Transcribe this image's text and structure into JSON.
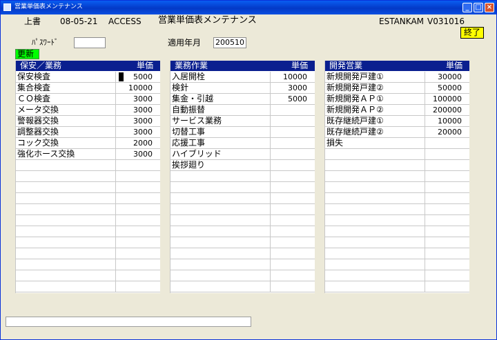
{
  "window": {
    "title": "営業単価表メンテナンス"
  },
  "header": {
    "mode": "上書",
    "date": "08-05-21",
    "app": "ACCESS",
    "screen_title": "営業単価表メンテナンス",
    "user": "ESTANKAM",
    "program_id": "V031016",
    "end_label": "終了"
  },
  "form": {
    "password_label": "ﾊﾟｽﾜｰﾄﾞ",
    "password_value": "",
    "period_label": "適用年月",
    "period_value": "200510",
    "update_label": "更新"
  },
  "grids": [
    {
      "title": "保安／業務",
      "price_header": "単価",
      "rows": [
        {
          "name": "保安検査",
          "price": "5000"
        },
        {
          "name": "集合検査",
          "price": "10000"
        },
        {
          "name": "ＣＯ検査",
          "price": "3000"
        },
        {
          "name": "メータ交換",
          "price": "3000"
        },
        {
          "name": "警報器交換",
          "price": "3000"
        },
        {
          "name": "調整器交換",
          "price": "3000"
        },
        {
          "name": "コック交換",
          "price": "2000"
        },
        {
          "name": "強化ホース交換",
          "price": "3000"
        },
        {
          "name": "",
          "price": ""
        },
        {
          "name": "",
          "price": ""
        },
        {
          "name": "",
          "price": ""
        },
        {
          "name": "",
          "price": ""
        },
        {
          "name": "",
          "price": ""
        },
        {
          "name": "",
          "price": ""
        },
        {
          "name": "",
          "price": ""
        },
        {
          "name": "",
          "price": ""
        },
        {
          "name": "",
          "price": ""
        },
        {
          "name": "",
          "price": ""
        },
        {
          "name": "",
          "price": ""
        },
        {
          "name": "",
          "price": ""
        }
      ]
    },
    {
      "title": "業務作業",
      "price_header": "単価",
      "rows": [
        {
          "name": "入居開栓",
          "price": "10000"
        },
        {
          "name": "検針",
          "price": "3000"
        },
        {
          "name": "集金・引越",
          "price": "5000"
        },
        {
          "name": "自動振替",
          "price": ""
        },
        {
          "name": "サービス業務",
          "price": ""
        },
        {
          "name": "切替工事",
          "price": ""
        },
        {
          "name": "応援工事",
          "price": ""
        },
        {
          "name": "ハイブリッド",
          "price": ""
        },
        {
          "name": "挨拶廻り",
          "price": ""
        },
        {
          "name": "",
          "price": ""
        },
        {
          "name": "",
          "price": ""
        },
        {
          "name": "",
          "price": ""
        },
        {
          "name": "",
          "price": ""
        },
        {
          "name": "",
          "price": ""
        },
        {
          "name": "",
          "price": ""
        },
        {
          "name": "",
          "price": ""
        },
        {
          "name": "",
          "price": ""
        },
        {
          "name": "",
          "price": ""
        },
        {
          "name": "",
          "price": ""
        },
        {
          "name": "",
          "price": ""
        }
      ]
    },
    {
      "title": "開発営業",
      "price_header": "単価",
      "rows": [
        {
          "name": "新規開発戸建①",
          "price": "30000"
        },
        {
          "name": "新規開発戸建②",
          "price": "50000"
        },
        {
          "name": "新規開発ＡＰ①",
          "price": "100000"
        },
        {
          "name": "新規開発ＡＰ②",
          "price": "200000"
        },
        {
          "name": "既存継続戸建①",
          "price": "10000"
        },
        {
          "name": "既存継続戸建②",
          "price": "20000"
        },
        {
          "name": "損失",
          "price": ""
        },
        {
          "name": "",
          "price": ""
        },
        {
          "name": "",
          "price": ""
        },
        {
          "name": "",
          "price": ""
        },
        {
          "name": "",
          "price": ""
        },
        {
          "name": "",
          "price": ""
        },
        {
          "name": "",
          "price": ""
        },
        {
          "name": "",
          "price": ""
        },
        {
          "name": "",
          "price": ""
        },
        {
          "name": "",
          "price": ""
        },
        {
          "name": "",
          "price": ""
        },
        {
          "name": "",
          "price": ""
        },
        {
          "name": "",
          "price": ""
        },
        {
          "name": "",
          "price": ""
        }
      ]
    }
  ],
  "status": {
    "message": ""
  },
  "colors": {
    "grid_header": "#0a1f8f",
    "update_button": "#00ff00",
    "end_button": "#ffff00"
  }
}
